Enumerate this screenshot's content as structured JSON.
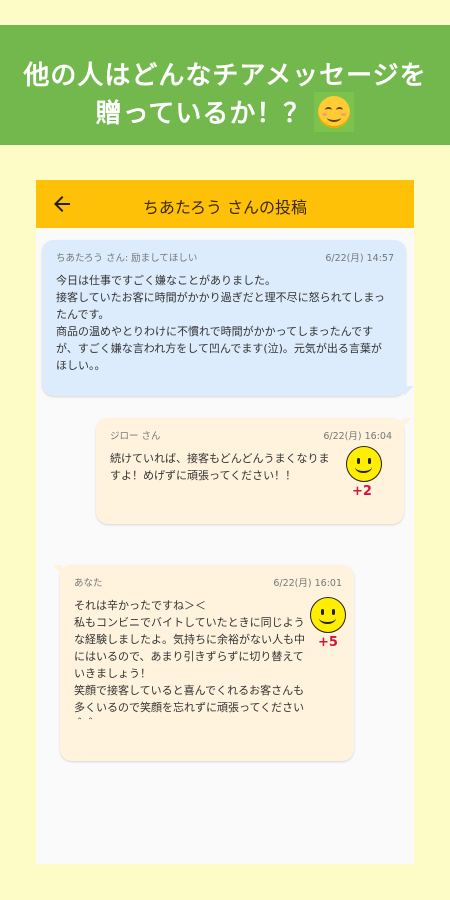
{
  "banner": {
    "line1": "他の人はどんなチアメッセージを",
    "line2": "贈っているか！？",
    "emoji_icon": "smiling-face-emoji"
  },
  "appbar": {
    "back_icon": "arrow-left-icon",
    "title": "ちあたろう さんの投稿"
  },
  "post": {
    "author": "ちあたろう さん: 励ましてほしい",
    "date": "6/22(月) 14:57",
    "body": "今日は仕事ですごく嫌なことがありました。\n接客していたお客に時間がかかり過ぎだと理不尽に怒られてしまったんです。\n商品の温めやとりわけに不慣れで時間がかかってしまったんですが、すごく嫌な言われ方をして凹んでます(泣)。元気が出る言葉がほしい。。"
  },
  "replies": [
    {
      "author": "ジロー さん",
      "date": "6/22(月) 16:04",
      "body": "続けていれば、接客もどんどんうまくなりますよ！めげずに頑張ってください！！",
      "score": "+2"
    },
    {
      "author": "あなた",
      "date": "6/22(月) 16:01",
      "body": "それは辛かったですね＞＜\n私もコンビニでバイトしていたときに同じような経験しましたよ。気持ちに余裕がない人も中にはいるので、あまり引きずらずに切り替えていきましょう！\n笑顔で接客していると喜んでくれるお客さんも多くいるので笑顔を忘れずに頑張ってください＾＾",
      "score": "+5"
    }
  ],
  "colors": {
    "background": "#fdfbc6",
    "banner": "#72b84c",
    "appbar": "#ffc107",
    "post_bubble": "#dcecfc",
    "reply_bubble": "#fff3de",
    "score": "#d0143a"
  }
}
